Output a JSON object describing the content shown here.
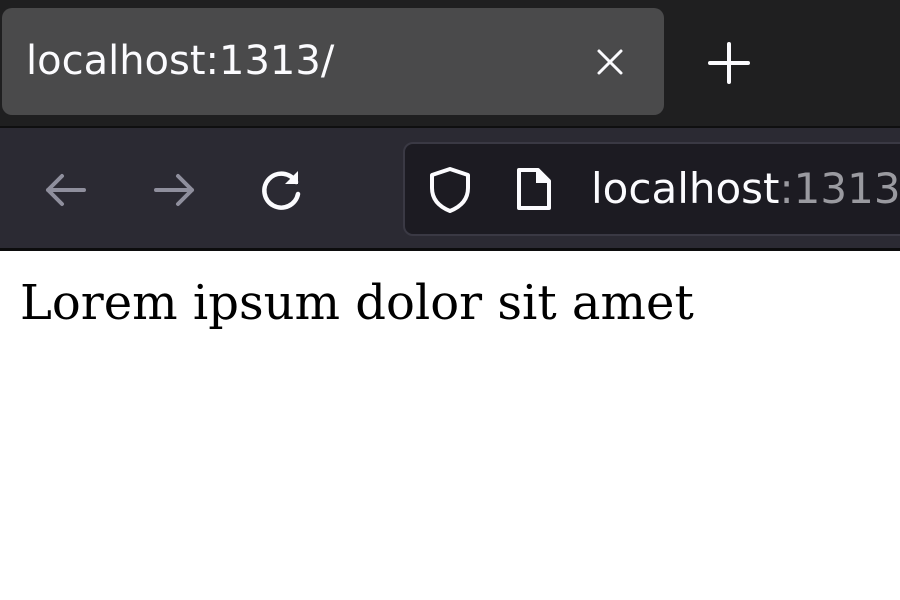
{
  "tabs": [
    {
      "title": "localhost:1313/"
    }
  ],
  "address_bar": {
    "host": "localhost",
    "port": ":1313"
  },
  "page": {
    "text": "Lorem ipsum dolor sit amet"
  },
  "icons": {
    "tab_close": "close-icon",
    "new_tab": "plus-icon",
    "back": "arrow-left-icon",
    "forward": "arrow-right-icon",
    "reload": "reload-icon",
    "tracking_protection": "shield-icon",
    "page_info": "page-icon"
  },
  "colors": {
    "tabstrip_bg": "#1f1f20",
    "active_tab_bg": "#4a4a4b",
    "navbar_bg": "#2b2a33",
    "urlbar_bg": "#1c1b22",
    "text_light": "#fbfbfe",
    "text_dim": "#9a9aa0",
    "disabled_icon": "#8f8f9d"
  }
}
